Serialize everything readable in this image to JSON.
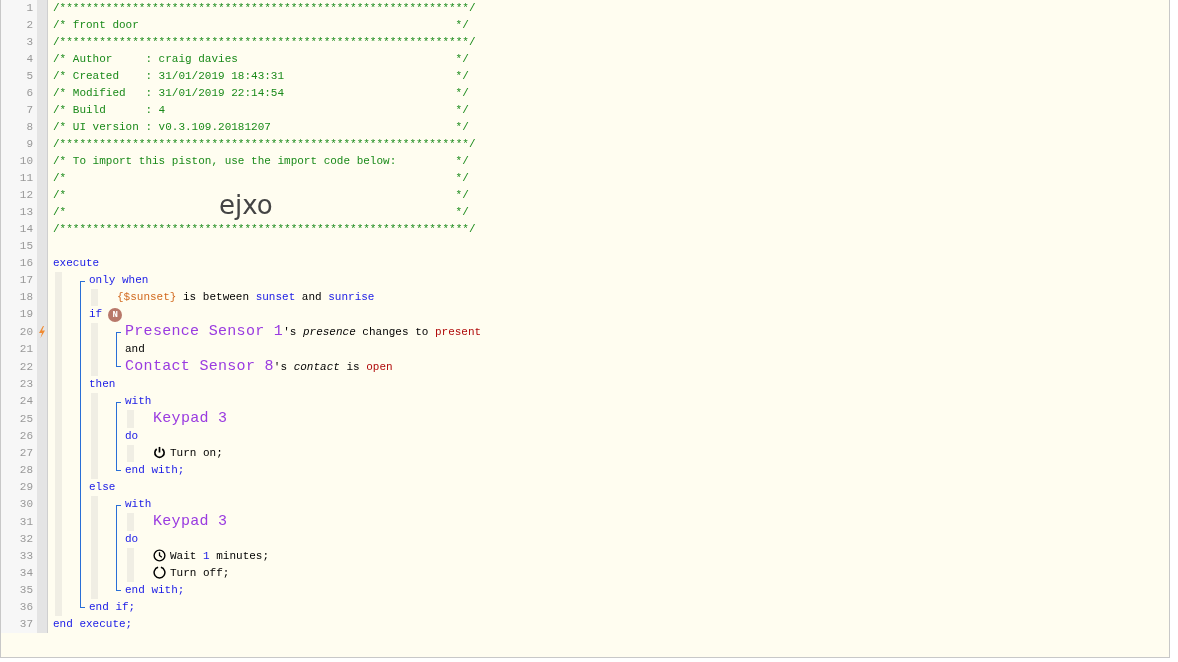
{
  "overlay_text": "ejxo",
  "lines": [
    {
      "number": "1",
      "trigger": false,
      "segments": [
        {
          "kind": "comment",
          "text": "/*************************************************************"
        },
        {
          "kind": "comment-end",
          "text": "*/"
        }
      ]
    },
    {
      "number": "2",
      "trigger": false,
      "segments": [
        {
          "kind": "comment",
          "text": "/* front door"
        },
        {
          "kind": "comment-end",
          "text": "*/"
        }
      ]
    },
    {
      "number": "3",
      "trigger": false,
      "segments": [
        {
          "kind": "comment",
          "text": "/*************************************************************"
        },
        {
          "kind": "comment-end",
          "text": "*/"
        }
      ]
    },
    {
      "number": "4",
      "trigger": false,
      "segments": [
        {
          "kind": "comment",
          "text": "/* Author     : craig davies"
        },
        {
          "kind": "comment-end",
          "text": "*/"
        }
      ]
    },
    {
      "number": "5",
      "trigger": false,
      "segments": [
        {
          "kind": "comment",
          "text": "/* Created    : 31/01/2019 18:43:31"
        },
        {
          "kind": "comment-end",
          "text": "*/"
        }
      ]
    },
    {
      "number": "6",
      "trigger": false,
      "segments": [
        {
          "kind": "comment",
          "text": "/* Modified   : 31/01/2019 22:14:54"
        },
        {
          "kind": "comment-end",
          "text": "*/"
        }
      ]
    },
    {
      "number": "7",
      "trigger": false,
      "segments": [
        {
          "kind": "comment",
          "text": "/* Build      : 4"
        },
        {
          "kind": "comment-end",
          "text": "*/"
        }
      ]
    },
    {
      "number": "8",
      "trigger": false,
      "segments": [
        {
          "kind": "comment",
          "text": "/* UI version : v0.3.109.20181207"
        },
        {
          "kind": "comment-end",
          "text": "*/"
        }
      ]
    },
    {
      "number": "9",
      "trigger": false,
      "segments": [
        {
          "kind": "comment",
          "text": "/*************************************************************"
        },
        {
          "kind": "comment-end",
          "text": "*/"
        }
      ]
    },
    {
      "number": "10",
      "trigger": false,
      "segments": [
        {
          "kind": "comment",
          "text": "/* To import this piston, use the import code below:"
        },
        {
          "kind": "comment-end",
          "text": "*/"
        }
      ]
    },
    {
      "number": "11",
      "trigger": false,
      "segments": [
        {
          "kind": "comment",
          "text": "/*"
        },
        {
          "kind": "comment-end",
          "text": "*/"
        }
      ]
    },
    {
      "number": "12",
      "trigger": false,
      "segments": [
        {
          "kind": "comment",
          "text": "/*"
        },
        {
          "kind": "comment-end",
          "text": "*/"
        }
      ]
    },
    {
      "number": "13",
      "trigger": false,
      "segments": [
        {
          "kind": "comment",
          "text": "/*"
        },
        {
          "kind": "comment-end",
          "text": "*/"
        }
      ]
    },
    {
      "number": "14",
      "trigger": false,
      "segments": [
        {
          "kind": "comment",
          "text": "/*************************************************************"
        },
        {
          "kind": "comment-end",
          "text": "*/"
        }
      ]
    },
    {
      "number": "15",
      "trigger": false
    },
    {
      "number": "16",
      "trigger": false,
      "segments": [
        {
          "kind": "keyword",
          "text": "execute"
        }
      ],
      "bracket": true,
      "children": [
        {
          "number": "17",
          "trigger": false,
          "segments": [
            {
              "kind": "keyword",
              "text": "only when"
            }
          ],
          "bracket": false,
          "children": [
            {
              "number": "18",
              "trigger": false,
              "segments": [
                {
                  "kind": "variable",
                  "text": "{$sunset}"
                },
                {
                  "kind": "plain",
                  "text": " is between "
                },
                {
                  "kind": "keyword",
                  "text": "sunset"
                },
                {
                  "kind": "plain",
                  "text": " and "
                },
                {
                  "kind": "keyword",
                  "text": "sunrise"
                }
              ]
            }
          ]
        },
        {
          "number": "19",
          "trigger": false,
          "segments": [
            {
              "kind": "keyword",
              "text": "if"
            },
            {
              "kind": "badge",
              "text": "N"
            }
          ],
          "bracket": true,
          "children": [
            {
              "number": "20",
              "trigger": true,
              "segments": [
                {
                  "kind": "device",
                  "text": "Presence Sensor 1"
                },
                {
                  "kind": "plain",
                  "text": "'s "
                },
                {
                  "kind": "attribute",
                  "text": "presence"
                },
                {
                  "kind": "plain",
                  "text": " changes to "
                },
                {
                  "kind": "value",
                  "text": "present"
                }
              ]
            },
            {
              "number": "21",
              "trigger": false,
              "segments": [
                {
                  "kind": "plain",
                  "text": "and"
                }
              ]
            },
            {
              "number": "22",
              "trigger": false,
              "segments": [
                {
                  "kind": "device",
                  "text": "Contact Sensor 8"
                },
                {
                  "kind": "plain",
                  "text": "'s "
                },
                {
                  "kind": "attribute",
                  "text": "contact"
                },
                {
                  "kind": "plain",
                  "text": " is "
                },
                {
                  "kind": "value",
                  "text": "open"
                }
              ]
            }
          ]
        },
        {
          "number": "23",
          "trigger": false,
          "segments": [
            {
              "kind": "keyword",
              "text": "then"
            }
          ],
          "bracket": true,
          "children": [
            {
              "number": "24",
              "trigger": false,
              "segments": [
                {
                  "kind": "keyword",
                  "text": "with"
                }
              ],
              "bracket": false,
              "children": [
                {
                  "number": "25",
                  "trigger": false,
                  "segments": [
                    {
                      "kind": "device",
                      "text": "Keypad 3"
                    }
                  ]
                }
              ]
            },
            {
              "number": "26",
              "trigger": false,
              "segments": [
                {
                  "kind": "keyword",
                  "text": "do"
                }
              ],
              "bracket": false,
              "children": [
                {
                  "number": "27",
                  "trigger": false,
                  "segments": [
                    {
                      "kind": "icon-power"
                    },
                    {
                      "kind": "plain",
                      "text": "Turn on;"
                    }
                  ]
                }
              ]
            },
            {
              "number": "28",
              "trigger": false,
              "segments": [
                {
                  "kind": "keyword",
                  "text": "end with;"
                }
              ]
            }
          ]
        },
        {
          "number": "29",
          "trigger": false,
          "segments": [
            {
              "kind": "keyword",
              "text": "else"
            }
          ],
          "bracket": true,
          "children": [
            {
              "number": "30",
              "trigger": false,
              "segments": [
                {
                  "kind": "keyword",
                  "text": "with"
                }
              ],
              "bracket": false,
              "children": [
                {
                  "number": "31",
                  "trigger": false,
                  "segments": [
                    {
                      "kind": "device",
                      "text": "Keypad 3"
                    }
                  ]
                }
              ]
            },
            {
              "number": "32",
              "trigger": false,
              "segments": [
                {
                  "kind": "keyword",
                  "text": "do"
                }
              ],
              "bracket": false,
              "children": [
                {
                  "number": "33",
                  "trigger": false,
                  "segments": [
                    {
                      "kind": "icon-clock"
                    },
                    {
                      "kind": "plain",
                      "text": "Wait "
                    },
                    {
                      "kind": "number",
                      "text": "1"
                    },
                    {
                      "kind": "plain",
                      "text": " minutes;"
                    }
                  ]
                },
                {
                  "number": "34",
                  "trigger": false,
                  "segments": [
                    {
                      "kind": "icon-off"
                    },
                    {
                      "kind": "plain",
                      "text": "Turn off;"
                    }
                  ]
                }
              ]
            },
            {
              "number": "35",
              "trigger": false,
              "segments": [
                {
                  "kind": "keyword",
                  "text": "end with;"
                }
              ]
            }
          ]
        },
        {
          "number": "36",
          "trigger": false,
          "segments": [
            {
              "kind": "keyword",
              "text": "end if;"
            }
          ]
        }
      ]
    },
    {
      "number": "37",
      "trigger": false,
      "segments": [
        {
          "kind": "keyword",
          "text": "end execute;"
        }
      ]
    }
  ]
}
